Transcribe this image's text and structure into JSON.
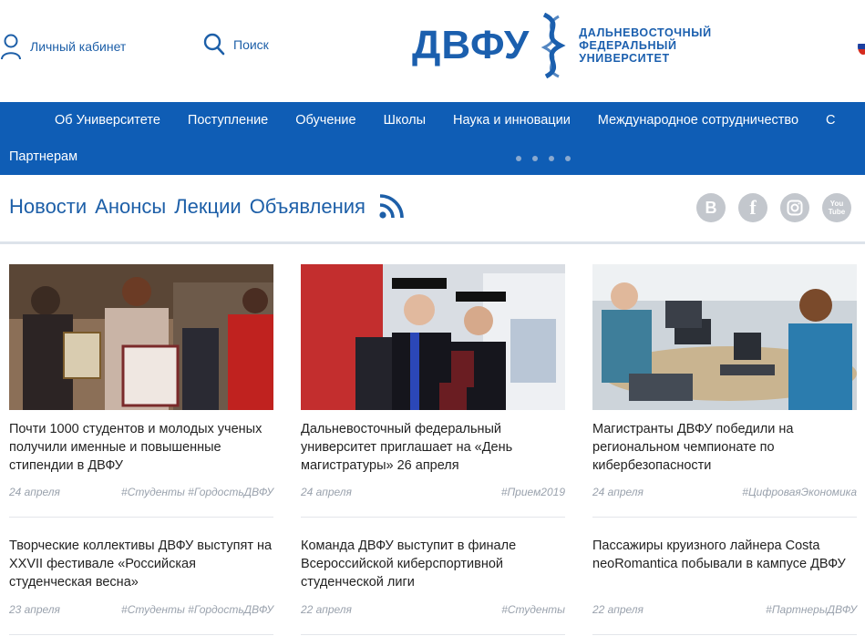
{
  "header": {
    "cabinet_label": "Личный кабинет",
    "search_label": "Поиск",
    "logo": {
      "word": "ДВФУ",
      "line1": "ДАЛЬНЕВОСТОЧНЫЙ",
      "line2": "ФЕДЕРАЛЬНЫЙ",
      "line3": "УНИВЕРСИТЕТ"
    }
  },
  "colors": {
    "brand_blue": "#1b5fae",
    "nav_bg": "#0f5db5",
    "link": "#1d5fa8",
    "meta_grey": "#9aa2ad"
  },
  "nav": {
    "items": [
      {
        "label": "Об Университете"
      },
      {
        "label": "Поступление"
      },
      {
        "label": "Обучение"
      },
      {
        "label": "Школы"
      },
      {
        "label": "Наука и инновации"
      },
      {
        "label": "Международное сотрудничество"
      },
      {
        "label": "С"
      }
    ],
    "partners_label": "Партнерам"
  },
  "tabs": [
    {
      "label": "Новости"
    },
    {
      "label": "Анонсы"
    },
    {
      "label": "Лекции"
    },
    {
      "label": "Объявления"
    }
  ],
  "socials": [
    {
      "icon": "vk-icon",
      "glyph": "B"
    },
    {
      "icon": "facebook-icon",
      "glyph": "f"
    },
    {
      "icon": "instagram-icon",
      "glyph": ""
    },
    {
      "icon": "youtube-icon",
      "glyph": "You Tube"
    }
  ],
  "news": [
    {
      "title": "Почти 1000 студентов и молодых ученых получили именные и повышенные стипендии в ДВФУ",
      "date": "24 апреля",
      "tags": [
        "#Студенты",
        "#ГордостьДВФУ"
      ]
    },
    {
      "title": "Дальневосточный федеральный университет приглашает на «День магистратуры» 26 апреля",
      "date": "24 апреля",
      "tags": [
        "#Прием2019"
      ]
    },
    {
      "title": "Магистранты ДВФУ победили на региональном чемпионате по кибербезопасности",
      "date": "24 апреля",
      "tags": [
        "#ЦифроваяЭкономика"
      ]
    },
    {
      "title": "Творческие коллективы ДВФУ выступят на XXVII фестивале «Российская студенческая весна»",
      "date": "23 апреля",
      "tags": [
        "#Студенты",
        "#ГордостьДВФУ"
      ]
    },
    {
      "title": "Команда ДВФУ выступит в финале Всероссийской киберспортивной студенческой лиги",
      "date": "22 апреля",
      "tags": [
        "#Студенты"
      ]
    },
    {
      "title": "Пассажиры круизного лайнера Costa neoRomantica побывали в кампусе ДВФУ",
      "date": "22 апреля",
      "tags": [
        "#ПартнерыДВФУ"
      ]
    }
  ]
}
